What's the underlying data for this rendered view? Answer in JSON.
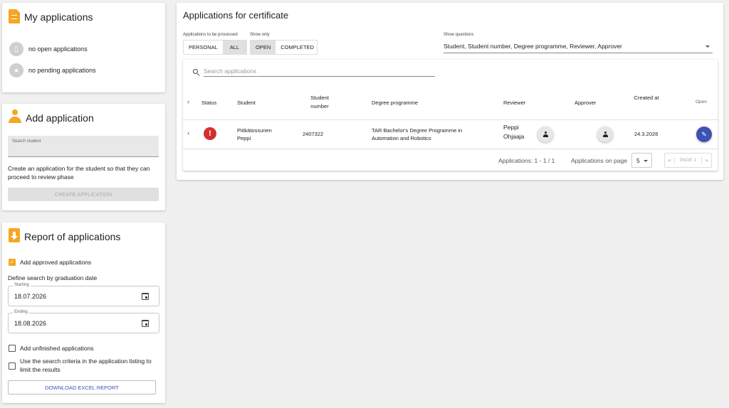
{
  "my_apps": {
    "title": "My applications",
    "no_open": "no open applications",
    "no_pending": "no pending applications"
  },
  "add_app": {
    "title": "Add application",
    "search_label": "Search student",
    "description": "Create an application for the student so that they can proceed to review phase",
    "create_button": "CREATE APPLICATION"
  },
  "report": {
    "title": "Report of applications",
    "add_approved": "Add approved applications",
    "define_search": "Define search by graduation date",
    "starting_label": "Starting",
    "starting_value": "18.07.2026",
    "ending_label": "Ending",
    "ending_value": "18.08.2026",
    "add_unfinished": "Add unfinished applications",
    "use_criteria": "Use the search criteria in the application listing to limit the results",
    "download_button": "DOWNLOAD EXCEL REPORT"
  },
  "main": {
    "title": "Applications for certificate",
    "to_be_processed_label": "Applications to be processed",
    "show_only_label": "Show only",
    "personal": "PERSONAL",
    "all": "ALL",
    "open": "OPEN",
    "completed": "COMPLETED",
    "show_questions_label": "Show questions",
    "show_questions_value": "Student, Student number, Degree programme, Reviewer, Approver",
    "search_placeholder": "Search applications",
    "columns": {
      "status": "Status",
      "student": "Student",
      "student_number": "Student number",
      "degree": "Degree programme",
      "reviewer": "Reviewer",
      "approver": "Approver",
      "created": "Created at",
      "open": "Open"
    },
    "row": {
      "student": "Piitkätossunen Peppi",
      "student_number": "2407322",
      "degree": "TAR Bachelor's Degree Programme in Automation and Robotics",
      "reviewer": "Peppi Ohjaaja",
      "created": "24.3.2026"
    },
    "footer": {
      "range": "Applications: 1 - 1 / 1",
      "per_page_label": "Applications on page",
      "per_page_value": "5",
      "page": "PAGE 1"
    }
  },
  "colors": {
    "accent": "#f5a623",
    "status_red": "#d32f2f",
    "open_button": "#3f51b5"
  }
}
